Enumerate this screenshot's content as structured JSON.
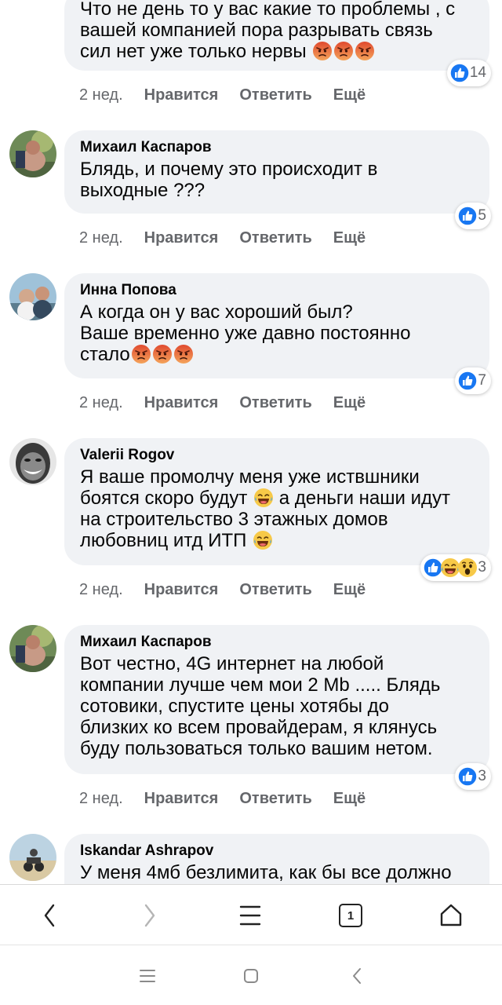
{
  "comments": [
    {
      "author": "",
      "lines": [
        "Что не день то у вас какие то проблемы , с",
        "вашей компанией пора разрывать связь",
        "сил нет уже только нервы"
      ],
      "reaction_count": "14",
      "time": "2 нед."
    },
    {
      "author": "Михаил Каспаров",
      "lines": [
        "Блядь, и почему это происходит в",
        "выходные ???"
      ],
      "reaction_count": "5",
      "time": "2 нед."
    },
    {
      "author": "Инна Попова",
      "lines": [
        "А когда он у вас хороший был?",
        "Ваше временно уже давно постоянно",
        "стало"
      ],
      "reaction_count": "7",
      "time": "2 нед."
    },
    {
      "author": "Valerii Rogov",
      "lines": [
        "Я ваше промолчу меня уже иствшники",
        "боятся скоро будут",
        "а деньги наши идут",
        "на строительство 3 этажных домов",
        "любовниц итд ИТП"
      ],
      "reaction_count": "3",
      "time": "2 нед."
    },
    {
      "author": "Михаил Каспаров",
      "lines": [
        "Вот честно, 4G интернет на любой",
        "компании лучше чем мои 2 Mb ..... Блядь",
        "сотовики, спустите цены хотябы до",
        "близких ко всем провайдерам, я клянусь",
        "буду пользоваться только вашим нетом."
      ],
      "reaction_count": "3",
      "time": "2 нед."
    },
    {
      "author": "Iskandar Ashrapov",
      "lines": [
        "У меня 4мб безлимита, как бы все должно"
      ]
    }
  ],
  "actions": {
    "like": "Нравится",
    "reply": "Ответить",
    "more": "Ещё"
  },
  "browser": {
    "tab_count": "1"
  },
  "icons": {
    "like": "thumbs-up-icon",
    "angry": "angry-face-icon",
    "laugh": "laughing-face-icon",
    "wow": "wow-face-icon"
  },
  "colors": {
    "like_blue": "#1877f2",
    "bubble_bg": "#f0f2f5",
    "meta_gray": "#65676b",
    "angry_red": "#e9593c"
  }
}
